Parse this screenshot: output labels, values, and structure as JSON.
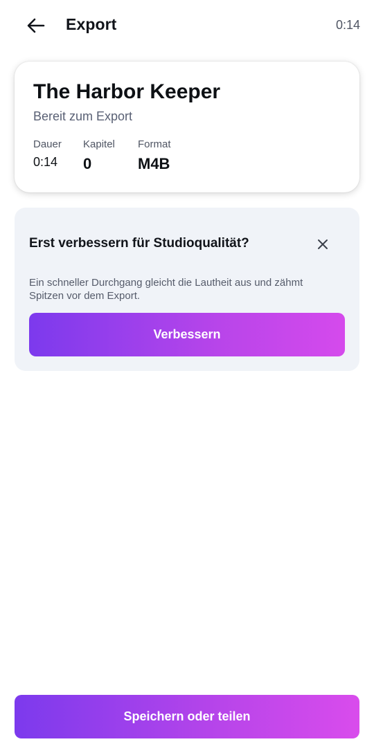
{
  "header": {
    "back_icon": "arrow-left-icon",
    "title": "Export",
    "time": "0:14"
  },
  "summary": {
    "title": "The Harbor Keeper",
    "status": "Bereit zum Export",
    "stats": [
      {
        "label": "Dauer",
        "value": "0:14"
      },
      {
        "label": "Kapitel",
        "value": "0"
      },
      {
        "label": "Format",
        "value": "M4B"
      }
    ]
  },
  "enhance": {
    "title": "Erst verbessern für Studioqualität?",
    "close_icon": "close-icon",
    "description": "Ein schneller Durchgang gleicht die Lautheit aus und zähmt Spitzen vor dem Export.",
    "button_label": "Verbessern"
  },
  "footer": {
    "save_label": "Speichern oder teilen"
  },
  "colors": {
    "accent_start": "#7c3aed",
    "accent_end": "#d94cec",
    "card_bg": "#f0f3f8"
  }
}
